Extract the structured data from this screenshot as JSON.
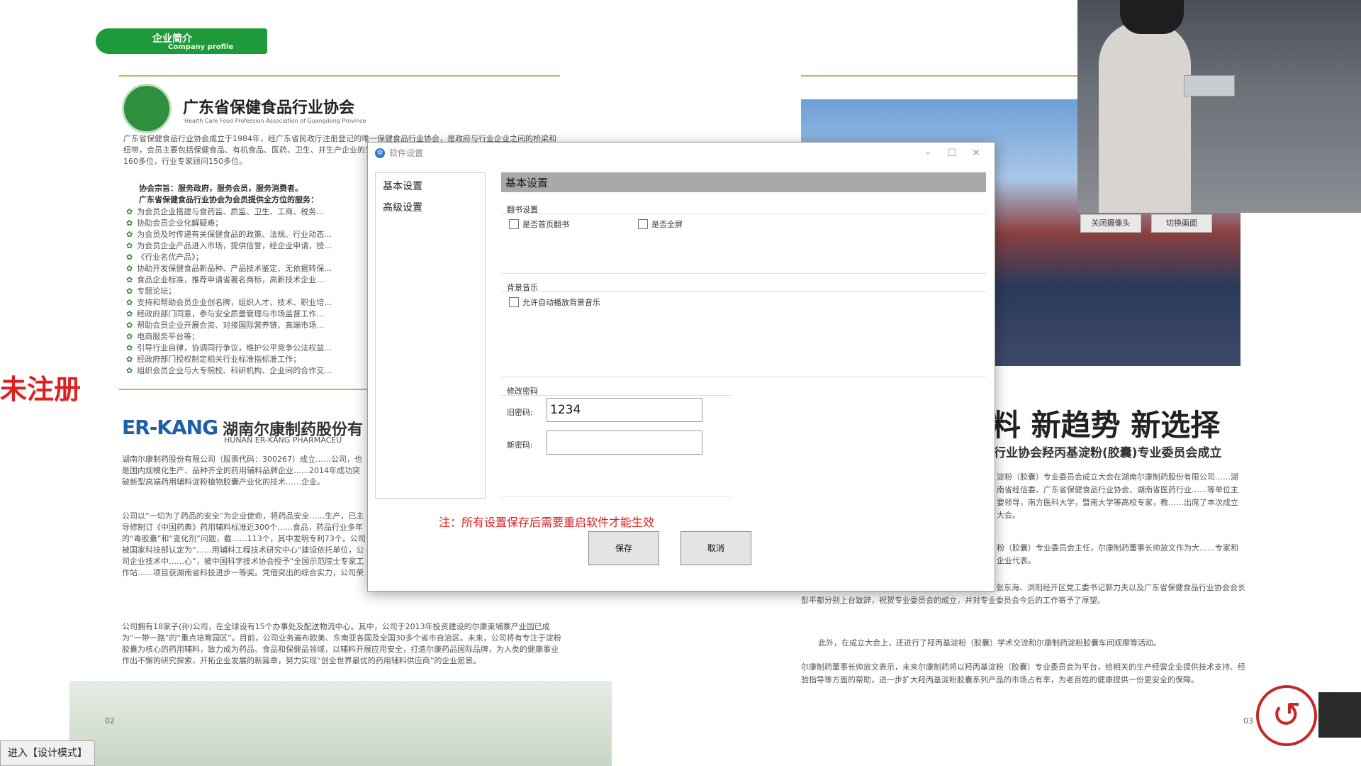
{
  "background_left": {
    "banner_cn": "企业简介",
    "banner_en": "Company profile",
    "org1_title": "广东省保健食品行业协会",
    "org1_subtitle": "Health Care Food Profession Association of Guangdong Province",
    "org1_para1": "广东省保健食品行业协会成立于1984年，经广东省民政厅注册登记的唯一保健食品行业协会，是政府与行业企业之间的桥梁和纽带，会员主要包括保健食品、有机食品、医药、卫生、并生产企业的生产、经营服务单位；有会员单位500多家，领导班子160多位，行业专家顾问150多位。",
    "org1_mission": "协会宗旨：服务政府，服务会员，服务消费者。",
    "org1_services_title": "广东省保健食品行业协会为会员提供全方位的服务：",
    "org1_bullets": [
      "为会员企业搭建与食药监、质监、卫生、工商、税务…",
      "协助会员企业化解疑难；",
      "为会员及时传递有关保健食品的政策、法规、行业动态…",
      "为会员企业产品进入市场，提供信誉，经企业申请，授…",
      "《行业名优产品》；",
      "协助开发保健食品新品种、产品技术鉴定、无依据转保…",
      "食品企业标准，推荐申请省著名商标，高新技术企业…",
      "专题论坛；",
      "支持和帮助会员企业创名牌，组织人才、技术、职业培…",
      "经政府部门同意，参与安全质量管理与市场监督工作…",
      "帮助会员企业开展合资、对接国际营养链、高端市场…",
      "电商服务平台等；",
      "引导行业自律，协调同行争议，维护公平竞争公法权益…",
      "经政府部门授权制定相关行业标准指标准工作；",
      "组织会员企业与大专院校、科研机构、企业间的合作交…"
    ],
    "org2_logo": "ER-KANG",
    "org2_title": "湖南尔康制药股份有",
    "org2_subtitle": "HUNAN ER-KANG PHARMACEU",
    "org2_para1": "湖南尔康制药股份有限公司（股票代码：300267）成立……公司，也是国内规模化生产、品种齐全的药用辅料品牌企业……2014年成功突破新型高端药用辅料淀粉植物胶囊产业化的技术……企业。",
    "org2_para2": "公司以“一切为了药品的安全”为企业使命，将药品安全……生产，已主导修制订《中国药典》药用辅料标准近300个……食品，药品行业多年的“毒胶囊”和“变化剂”问题，截……113个，其中发明专利73个。公司被国家科技部认定为“……用辅料工程技术研究中心”建设依托单位，公司企业技术中……心”，被中国科学技术协会授予“全国示范院士专家工作站……项目获湖南省科技进步一等奖。凭借突出的综合实力，公司荣获了“亚洲中小上市公司200强”、“全国上市公司百强”、“全国医药上市公司前十强”、“全国医药行业百强企业100强”等多项荣誉。",
    "org2_para3": "公司拥有18家子(孙)公司，在全球设有15个办事处及配送物流中心。其中，公司于2013年投资建设的尔康柬埔寨产业园已成为“一带一路”的“重点培育园区”。目前，公司业务遍布欧美、东南亚各国及全国30多个省市自治区。未来，公司将有专注于淀粉胶囊为核心的药用辅料，致力成为药品、食品和保健品领域，以辅料开展应用安全，打造尔康药品国际品牌，为人类的健康事业作出不懈的研究探索，开拓企业发展的新篇章，努力实现“创全世界最优的药用辅料供应商”的企业愿景。",
    "page_num": "02"
  },
  "background_right": {
    "headline": "料 新趋势 新选择",
    "subheadline": "行业协会羟丙基淀粉(胶囊)专业委员会成立",
    "para1": "淀粉（胶囊）专业委员会成立大会在湖南尔康制药股份有限公司……湖南省经信委、广东省保健食品行业协会、湖南省医药行业……等单位主要领导，南方医科大学，暨南大学等高校专家，教……出席了本次成立大会。",
    "para2": "粉（胶囊）专业委员会主任，尔康制药董事长帅放文作为大……专家和企业代表。",
    "para3": "……广东省食药监局副局长严振、湖南省经信委副巡视员张东海、浏阳经开区党工委书记郭力夫以及广东省保健食品行业协会会长彭平都分别上台致辞，祝贺专业委员会的成立，并对专业委员会今后的工作寄予了厚望。",
    "para4": "此外，在成立大会上，还进行了羟丙基淀粉（胶囊）学术交流和尔康制药淀粉胶囊车间观摩等活动。",
    "para5": "尔康制药董事长帅放文表示，未来尔康制药将以羟丙基淀粉（胶囊）专业委员会为平台，给相关的生产经营企业提供技术支持、经验指导等方面的帮助，进一步扩大羟丙基淀粉胶囊系列产品的市场占有率，为老百姓的健康提供一份更安全的保障。",
    "page_num": "03"
  },
  "webcam": {
    "close_camera": "关闭摄像头",
    "switch_view": "切换画面"
  },
  "overlay": {
    "unregistered": "未注册",
    "design_mode": "进入【设计模式】"
  },
  "dialog": {
    "title": "软件设置",
    "app_icon": "gear-icon",
    "controls": {
      "minimize": "–",
      "maximize": "☐",
      "close": "✕"
    },
    "nav": [
      "基本设置",
      "高级设置"
    ],
    "header": "基本设置",
    "page_turn_group": "翻书设置",
    "cb_flip_first_page": "是否首页翻书",
    "cb_fullscreen": "是否全屏",
    "music_group": "背景音乐",
    "cb_autoplay_music": "允许自动播放背景音乐",
    "password_group": "修改密码",
    "old_password_label": "旧密码:",
    "old_password_value": "1234",
    "new_password_label": "新密码:",
    "new_password_value": "",
    "note": "注：所有设置保存后需要重启软件才能生效",
    "save": "保存",
    "cancel": "取消"
  }
}
